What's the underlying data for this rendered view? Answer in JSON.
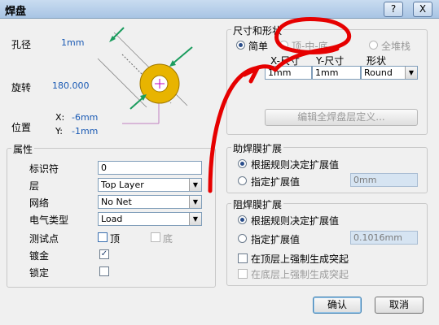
{
  "window": {
    "title": "焊盘",
    "help_btn": "?",
    "close_btn": "X"
  },
  "graphic": {
    "hole_label": "孔径",
    "hole_value": "1mm",
    "rotation_label": "旋转",
    "rotation_value": "180.000",
    "position_label": "位置",
    "x_label": "X:",
    "x_value": "-6mm",
    "y_label": "Y:",
    "y_value": "-1mm"
  },
  "properties": {
    "group_title": "属性",
    "designator_label": "标识符",
    "designator_value": "0",
    "layer_label": "层",
    "layer_value": "Top Layer",
    "net_label": "网络",
    "net_value": "No Net",
    "elec_type_label": "电气类型",
    "elec_type_value": "Load",
    "testpoint_label": "测试点",
    "testpoint_top": "顶",
    "testpoint_bottom": "底",
    "plated_label": "镀金",
    "locked_label": "锁定",
    "check_mark": "✓"
  },
  "size_shape": {
    "group_title": "尺寸和形状",
    "mode_simple": "简单",
    "mode_top_mid_bottom": "顶-中-底",
    "mode_full_stack": "全堆栈",
    "col_x": "X-尺寸",
    "col_y": "Y-尺寸",
    "col_shape": "形状",
    "x_size": "1mm",
    "y_size": "1mm",
    "shape": "Round",
    "edit_stack_btn": "编辑全焊盘层定义..."
  },
  "paste_mask": {
    "group_title": "助焊膜扩展",
    "opt_rule": "根据规则决定扩展值",
    "opt_specify": "指定扩展值",
    "value": "0mm"
  },
  "solder_mask": {
    "group_title": "阻焊膜扩展",
    "opt_rule": "根据规则决定扩展值",
    "opt_specify": "指定扩展值",
    "value": "0.1016mm",
    "force_top": "在顶层上强制生成突起",
    "force_bottom": "在底层上强制生成突起"
  },
  "buttons": {
    "ok": "确认",
    "cancel": "取消"
  },
  "colors": {
    "pad_ring": "#e8b400",
    "arrows": "#1b9c5e",
    "annotation": "#e60000"
  }
}
